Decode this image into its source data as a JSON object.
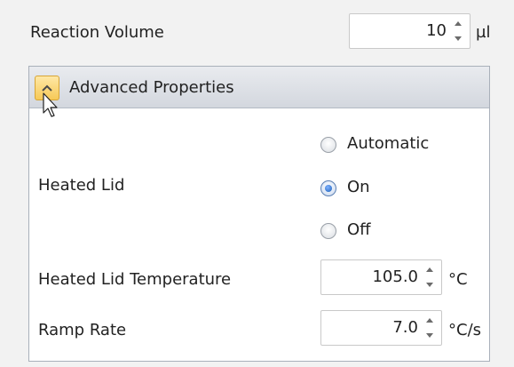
{
  "reaction_volume": {
    "label": "Reaction Volume",
    "value": "10",
    "unit": "µl"
  },
  "advanced_panel": {
    "title": "Advanced Properties",
    "heated_lid": {
      "label": "Heated Lid",
      "options": [
        {
          "label": "Automatic",
          "checked": false
        },
        {
          "label": "On",
          "checked": true
        },
        {
          "label": "Off",
          "checked": false
        }
      ]
    },
    "heated_lid_temperature": {
      "label": "Heated Lid Temperature",
      "value": "105.0",
      "unit": "°C"
    },
    "ramp_rate": {
      "label": "Ramp Rate",
      "value": "7.0",
      "unit": "°C/s"
    }
  }
}
